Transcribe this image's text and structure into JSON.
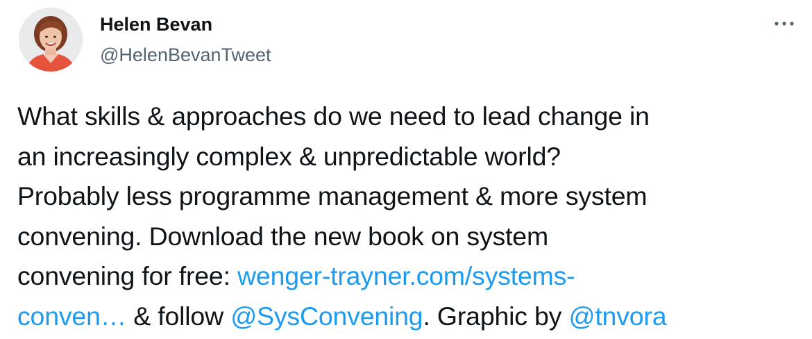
{
  "author": {
    "display_name": "Helen Bevan",
    "handle": "@HelenBevanTweet"
  },
  "icons": {
    "avatar": "profile-photo",
    "more": "more-options-icon"
  },
  "colors": {
    "text": "#0f1419",
    "secondary": "#536471",
    "link": "#1d9bf0"
  },
  "tweet": {
    "line1": "What skills & approaches do we need to lead change in",
    "line2": "an increasingly complex & unpredictable world?",
    "line3": "Probably less programme management & more system",
    "line4": "convening. Download the new book on system",
    "line5_text": "convening for free: ",
    "line5_link": "wenger-trayner.com/systems-",
    "line6_link": "conven…",
    "line6_text1": " & follow ",
    "mention1": "@SysConvening",
    "line6_text2": ". Graphic by ",
    "mention2": "@tnvora"
  }
}
